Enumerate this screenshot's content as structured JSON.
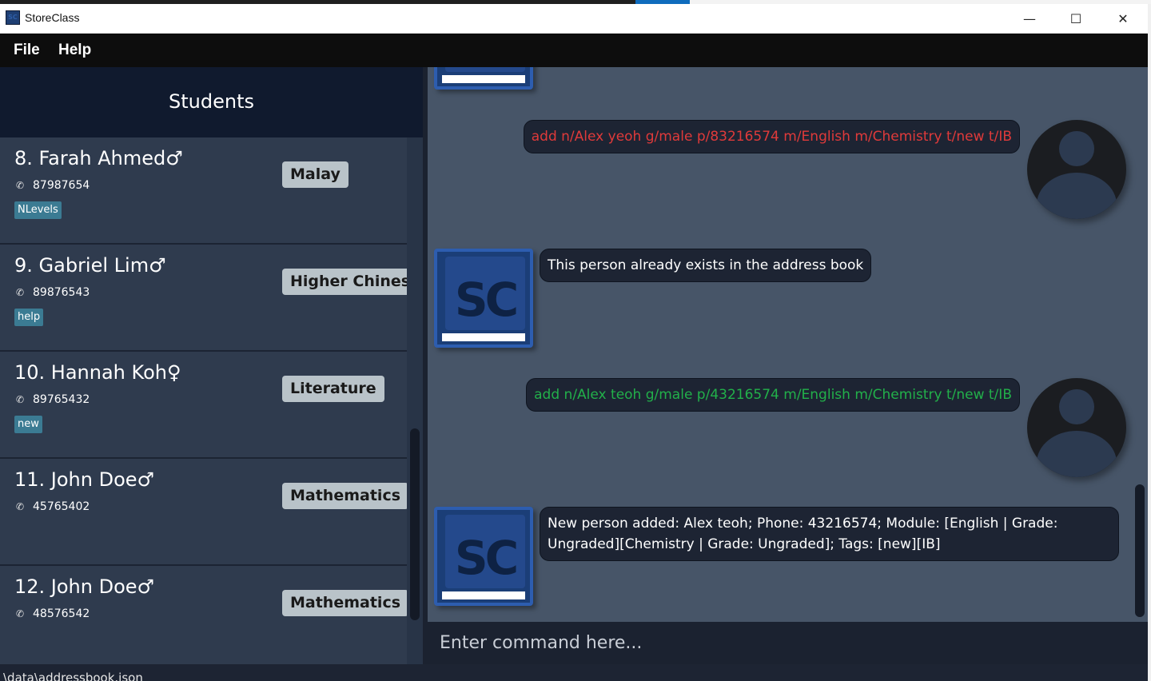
{
  "window": {
    "title": "StoreClass",
    "icon_label": "SC",
    "minimize_glyph": "—",
    "maximize_glyph": "☐",
    "close_glyph": "✕"
  },
  "menu": {
    "file": "File",
    "help": "Help"
  },
  "students_panel": {
    "title": "Students",
    "cards": [
      {
        "name": "8. Farah Ahmed♂",
        "phone": "87987654",
        "tag": "NLevels",
        "module": "Malay"
      },
      {
        "name": "9. Gabriel Lim♂",
        "phone": "89876543",
        "tag": "help",
        "module": "Higher Chinese"
      },
      {
        "name": "10. Hannah Koh♀",
        "phone": "89765432",
        "tag": "new",
        "module": "Literature"
      },
      {
        "name": "11. John Doe♂",
        "phone": "45765402",
        "tag": "",
        "module": "Mathematics"
      },
      {
        "name": "12. John  Doe♂",
        "phone": "48576542",
        "tag": "",
        "module": "Mathematics"
      }
    ]
  },
  "chat": {
    "messages": [
      {
        "sender": "user",
        "text": "add n/Alex yeoh g/male p/83216574 m/English m/Chemistry t/new t/IB",
        "status": "error"
      },
      {
        "sender": "app",
        "text": "This person already exists in the address book"
      },
      {
        "sender": "user",
        "text": "add n/Alex teoh g/male p/43216574 m/English m/Chemistry t/new t/IB",
        "status": "success"
      },
      {
        "sender": "app",
        "text_line1": "New person added: Alex teoh; Phone: 43216574; Module: [English | Grade:",
        "text_line2": "Ungraded][Chemistry | Grade: Ungraded]; Tags: [new][IB]"
      }
    ]
  },
  "command": {
    "placeholder": "Enter command here..."
  },
  "status_bar": {
    "path": "\\data\\addressbook.json"
  },
  "icons": {
    "phone": "phone-icon",
    "user_avatar": "user-avatar-icon",
    "app_avatar": "storeclass-logo-icon"
  },
  "colors": {
    "error_text": "#e03a3a",
    "success_text": "#22b04a",
    "tag_bg": "#3b7b93",
    "module_bg": "#b9c3c9",
    "header_bg": "#101a2e"
  }
}
